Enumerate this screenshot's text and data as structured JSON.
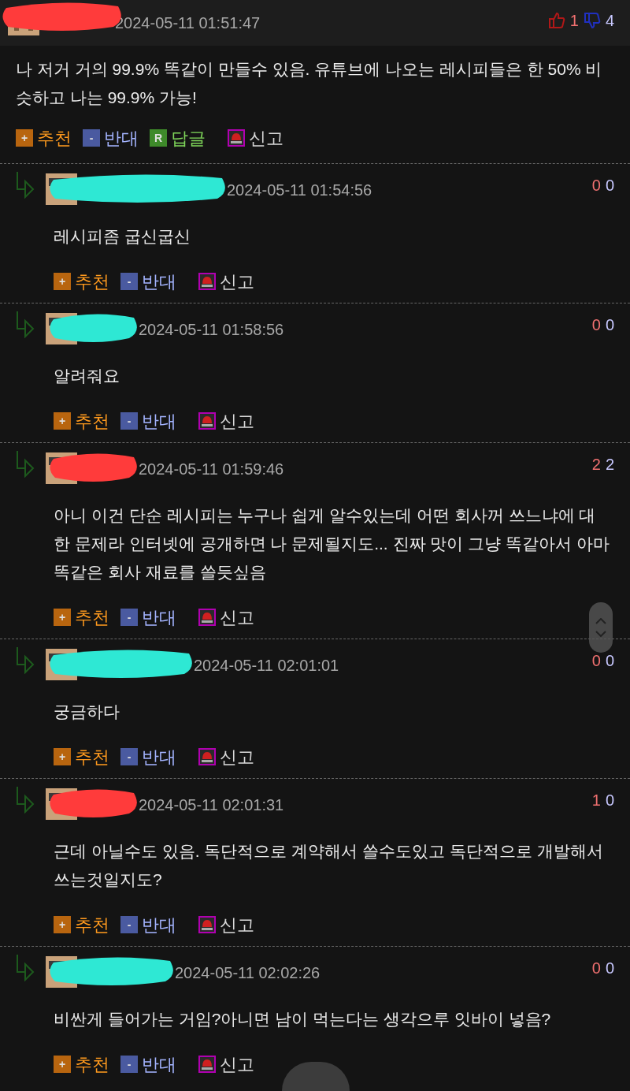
{
  "main_comment": {
    "time": "2024-05-11 01:51:47",
    "up": "1",
    "down": "4",
    "body": "나 저거 거의 99.9% 똑같이 만들수 있음. 유튜브에 나오는 레시피들은 한 50% 비슷하고 나는 99.9% 가능!",
    "actions": [
      {
        "kind": "recommend",
        "icon": "+",
        "label": "추천"
      },
      {
        "kind": "oppose",
        "icon": "-",
        "label": "반대"
      },
      {
        "kind": "reply",
        "icon": "R",
        "label": "답글"
      },
      {
        "kind": "report",
        "label": "신고"
      }
    ]
  },
  "replies": [
    {
      "time": "2024-05-11 01:54:56",
      "up": "0",
      "down": "0",
      "body": "레시피좀 굽신굽신",
      "actions": [
        {
          "kind": "recommend",
          "icon": "+",
          "label": "추천"
        },
        {
          "kind": "oppose",
          "icon": "-",
          "label": "반대"
        },
        {
          "kind": "report",
          "label": "신고"
        }
      ]
    },
    {
      "time": "2024-05-11 01:58:56",
      "up": "0",
      "down": "0",
      "body": "알려줘요",
      "actions": [
        {
          "kind": "recommend",
          "icon": "+",
          "label": "추천"
        },
        {
          "kind": "oppose",
          "icon": "-",
          "label": "반대"
        },
        {
          "kind": "report",
          "label": "신고"
        }
      ]
    },
    {
      "time": "2024-05-11 01:59:46",
      "up": "2",
      "down": "2",
      "body": "아니 이건 단순 레시피는 누구나 쉽게 알수있는데 어떤 회사꺼 쓰느냐에 대한 문제라 인터넷에 공개하면 나 문제될지도... 진짜 맛이 그냥 똑같아서 아마 똑같은 회사 재료를 쓸듯싶음",
      "actions": [
        {
          "kind": "recommend",
          "icon": "+",
          "label": "추천"
        },
        {
          "kind": "oppose",
          "icon": "-",
          "label": "반대"
        },
        {
          "kind": "report",
          "label": "신고"
        }
      ]
    },
    {
      "time": "2024-05-11 02:01:01",
      "up": "0",
      "down": "0",
      "body": "궁금하다",
      "actions": [
        {
          "kind": "recommend",
          "icon": "+",
          "label": "추천"
        },
        {
          "kind": "oppose",
          "icon": "-",
          "label": "반대"
        },
        {
          "kind": "report",
          "label": "신고"
        }
      ]
    },
    {
      "time": "2024-05-11 02:01:31",
      "up": "1",
      "down": "0",
      "body": "근데 아닐수도 있음. 독단적으로 계약해서 쓸수도있고 독단적으로 개발해서 쓰는것일지도?",
      "actions": [
        {
          "kind": "recommend",
          "icon": "+",
          "label": "추천"
        },
        {
          "kind": "oppose",
          "icon": "-",
          "label": "반대"
        },
        {
          "kind": "report",
          "label": "신고"
        }
      ]
    },
    {
      "time": "2024-05-11 02:02:26",
      "up": "0",
      "down": "0",
      "body": "비싼게 들어가는 거임?아니면 남이 먹는다는 생각으루 잇바이 넣음?",
      "actions": [
        {
          "kind": "recommend",
          "icon": "+",
          "label": "추천"
        },
        {
          "kind": "oppose",
          "icon": "-",
          "label": "반대"
        },
        {
          "kind": "report",
          "label": "신고"
        }
      ]
    }
  ]
}
